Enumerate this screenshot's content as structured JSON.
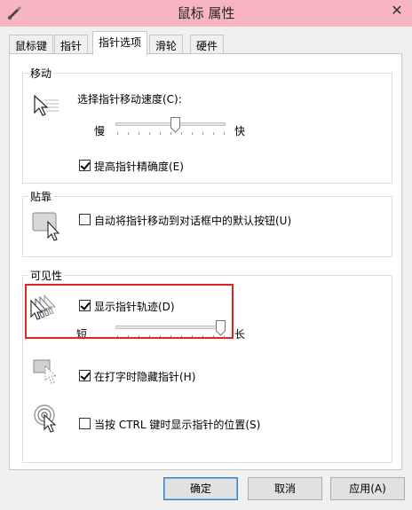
{
  "window": {
    "title": "鼠标 属性",
    "close_glyph": "✕"
  },
  "tabs": [
    {
      "label": "鼠标键"
    },
    {
      "label": "指针"
    },
    {
      "label": "指针选项",
      "active": true
    },
    {
      "label": "滑轮"
    },
    {
      "label": "硬件"
    }
  ],
  "motion": {
    "group_label": "移动",
    "speed_label": "选择指针移动速度(C):",
    "slow_label": "慢",
    "fast_label": "快",
    "speed_value": 0.55,
    "precision_label": "提高指针精确度(E)",
    "precision_checked": true
  },
  "snap": {
    "group_label": "贴靠",
    "snap_label": "自动将指针移动到对话框中的默认按钮(U)",
    "snap_checked": false
  },
  "visibility": {
    "group_label": "可见性",
    "trails_label": "显示指针轨迹(D)",
    "trails_checked": true,
    "short_label": "短",
    "long_label": "长",
    "trails_value": 1.0,
    "hide_label": "在打字时隐藏指针(H)",
    "hide_checked": true,
    "ctrl_label": "当按 CTRL 键时显示指针的位置(S)",
    "ctrl_checked": false
  },
  "buttons": {
    "ok": "确定",
    "cancel": "取消",
    "apply": "应用(A)"
  },
  "colors": {
    "titlebar": "#f6b5c0",
    "highlight": "#e02424",
    "default_button_border": "#3c7fb1"
  }
}
